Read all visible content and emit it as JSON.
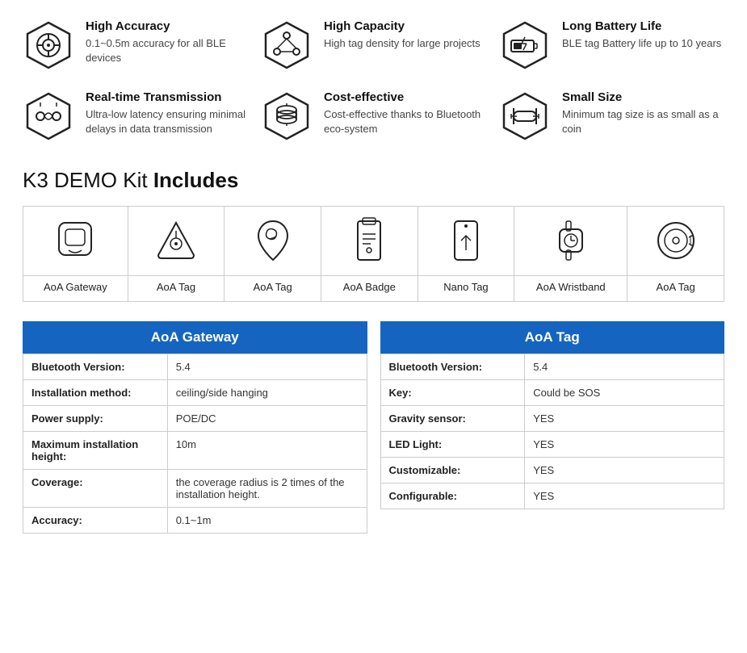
{
  "features": [
    {
      "id": "high-accuracy",
      "title": "High Accuracy",
      "description": "0.1~0.5m accuracy for all BLE devices",
      "icon": "target"
    },
    {
      "id": "high-capacity",
      "title": "High Capacity",
      "description": "High tag density for large projects",
      "icon": "nodes"
    },
    {
      "id": "long-battery",
      "title": "Long Battery Life",
      "description": "BLE tag Battery life up to 10 years",
      "icon": "battery"
    },
    {
      "id": "realtime",
      "title": "Real-time Transmission",
      "description": "Ultra-low latency ensuring minimal delays in data transmission",
      "icon": "transmission"
    },
    {
      "id": "cost-effective",
      "title": "Cost-effective",
      "description": "Cost-effective thanks to Bluetooth eco-system",
      "icon": "coins"
    },
    {
      "id": "small-size",
      "title": "Small Size",
      "description": "Minimum tag size is as small as a coin",
      "icon": "resize"
    }
  ],
  "demo_title_plain": "K3 DEMO Kit ",
  "demo_title_bold": "Includes",
  "kit_items": [
    {
      "label": "AoA Gateway",
      "icon": "gateway"
    },
    {
      "label": "AoA Tag",
      "icon": "tag-triangle"
    },
    {
      "label": "AoA Tag",
      "icon": "tag-pin"
    },
    {
      "label": "AoA Badge",
      "icon": "badge"
    },
    {
      "label": "Nano Tag",
      "icon": "nano"
    },
    {
      "label": "AoA Wristband",
      "icon": "wristband"
    },
    {
      "label": "AoA Tag",
      "icon": "tag-round"
    }
  ],
  "gateway": {
    "header": "AoA Gateway",
    "rows": [
      {
        "label": "Bluetooth Version:",
        "value": "5.4"
      },
      {
        "label": "Installation method:",
        "value": "ceiling/side hanging"
      },
      {
        "label": "Power supply:",
        "value": "POE/DC"
      },
      {
        "label": "Maximum installation height:",
        "value": "10m"
      },
      {
        "label": "Coverage:",
        "value": "the coverage radius is 2 times of the installation height."
      },
      {
        "label": "Accuracy:",
        "value": "0.1~1m"
      }
    ]
  },
  "aoa_tag": {
    "header": "AoA Tag",
    "rows": [
      {
        "label": "Bluetooth Version:",
        "value": "5.4"
      },
      {
        "label": "Key:",
        "value": "Could be SOS"
      },
      {
        "label": "Gravity sensor:",
        "value": "YES"
      },
      {
        "label": "LED Light:",
        "value": "YES"
      },
      {
        "label": "Customizable:",
        "value": "YES"
      },
      {
        "label": "Configurable:",
        "value": "YES"
      }
    ]
  }
}
